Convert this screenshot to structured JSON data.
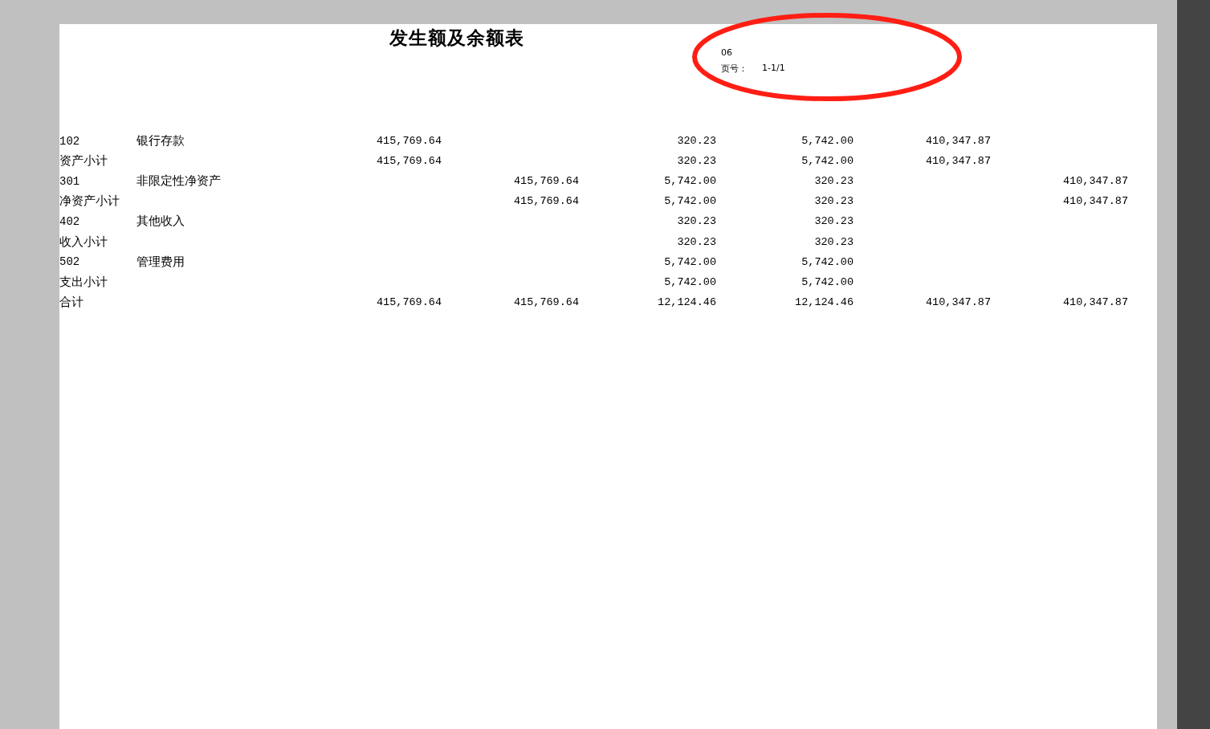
{
  "report": {
    "title": "发生额及余额表",
    "header": {
      "code": "06",
      "page_label": "页号：",
      "page_value": "1-1/1"
    },
    "rows": [
      {
        "kind": "account",
        "code": "102",
        "name": "银行存款",
        "amounts": {
          "column_3": "415,769.64",
          "column_5": "320.23",
          "column_6": "5,742.00",
          "column_7": "410,347.87"
        }
      },
      {
        "kind": "subtotal",
        "label": "资产小计",
        "amounts": {
          "column_3": "415,769.64",
          "column_5": "320.23",
          "column_6": "5,742.00",
          "column_7": "410,347.87"
        }
      },
      {
        "kind": "account",
        "code": "301",
        "name": "非限定性净资产",
        "amounts": {
          "column_4": "415,769.64",
          "column_5": "5,742.00",
          "column_6": "320.23",
          "column_8": "410,347.87"
        }
      },
      {
        "kind": "subtotal",
        "label": "净资产小计",
        "amounts": {
          "column_4": "415,769.64",
          "column_5": "5,742.00",
          "column_6": "320.23",
          "column_8": "410,347.87"
        }
      },
      {
        "kind": "account",
        "code": "402",
        "name": "其他收入",
        "amounts": {
          "column_5": "320.23",
          "column_6": "320.23"
        }
      },
      {
        "kind": "subtotal",
        "label": "收入小计",
        "amounts": {
          "column_5": "320.23",
          "column_6": "320.23"
        }
      },
      {
        "kind": "account",
        "code": "502",
        "name": "管理费用",
        "amounts": {
          "column_5": "5,742.00",
          "column_6": "5,742.00"
        }
      },
      {
        "kind": "subtotal",
        "label": "支出小计",
        "amounts": {
          "column_5": "5,742.00",
          "column_6": "5,742.00"
        }
      },
      {
        "kind": "subtotal",
        "label": "合计",
        "amounts": {
          "column_3": "415,769.64",
          "column_4": "415,769.64",
          "column_5": "12,124.46",
          "column_6": "12,124.46",
          "column_7": "410,347.87",
          "column_8": "410,347.87"
        }
      }
    ]
  }
}
